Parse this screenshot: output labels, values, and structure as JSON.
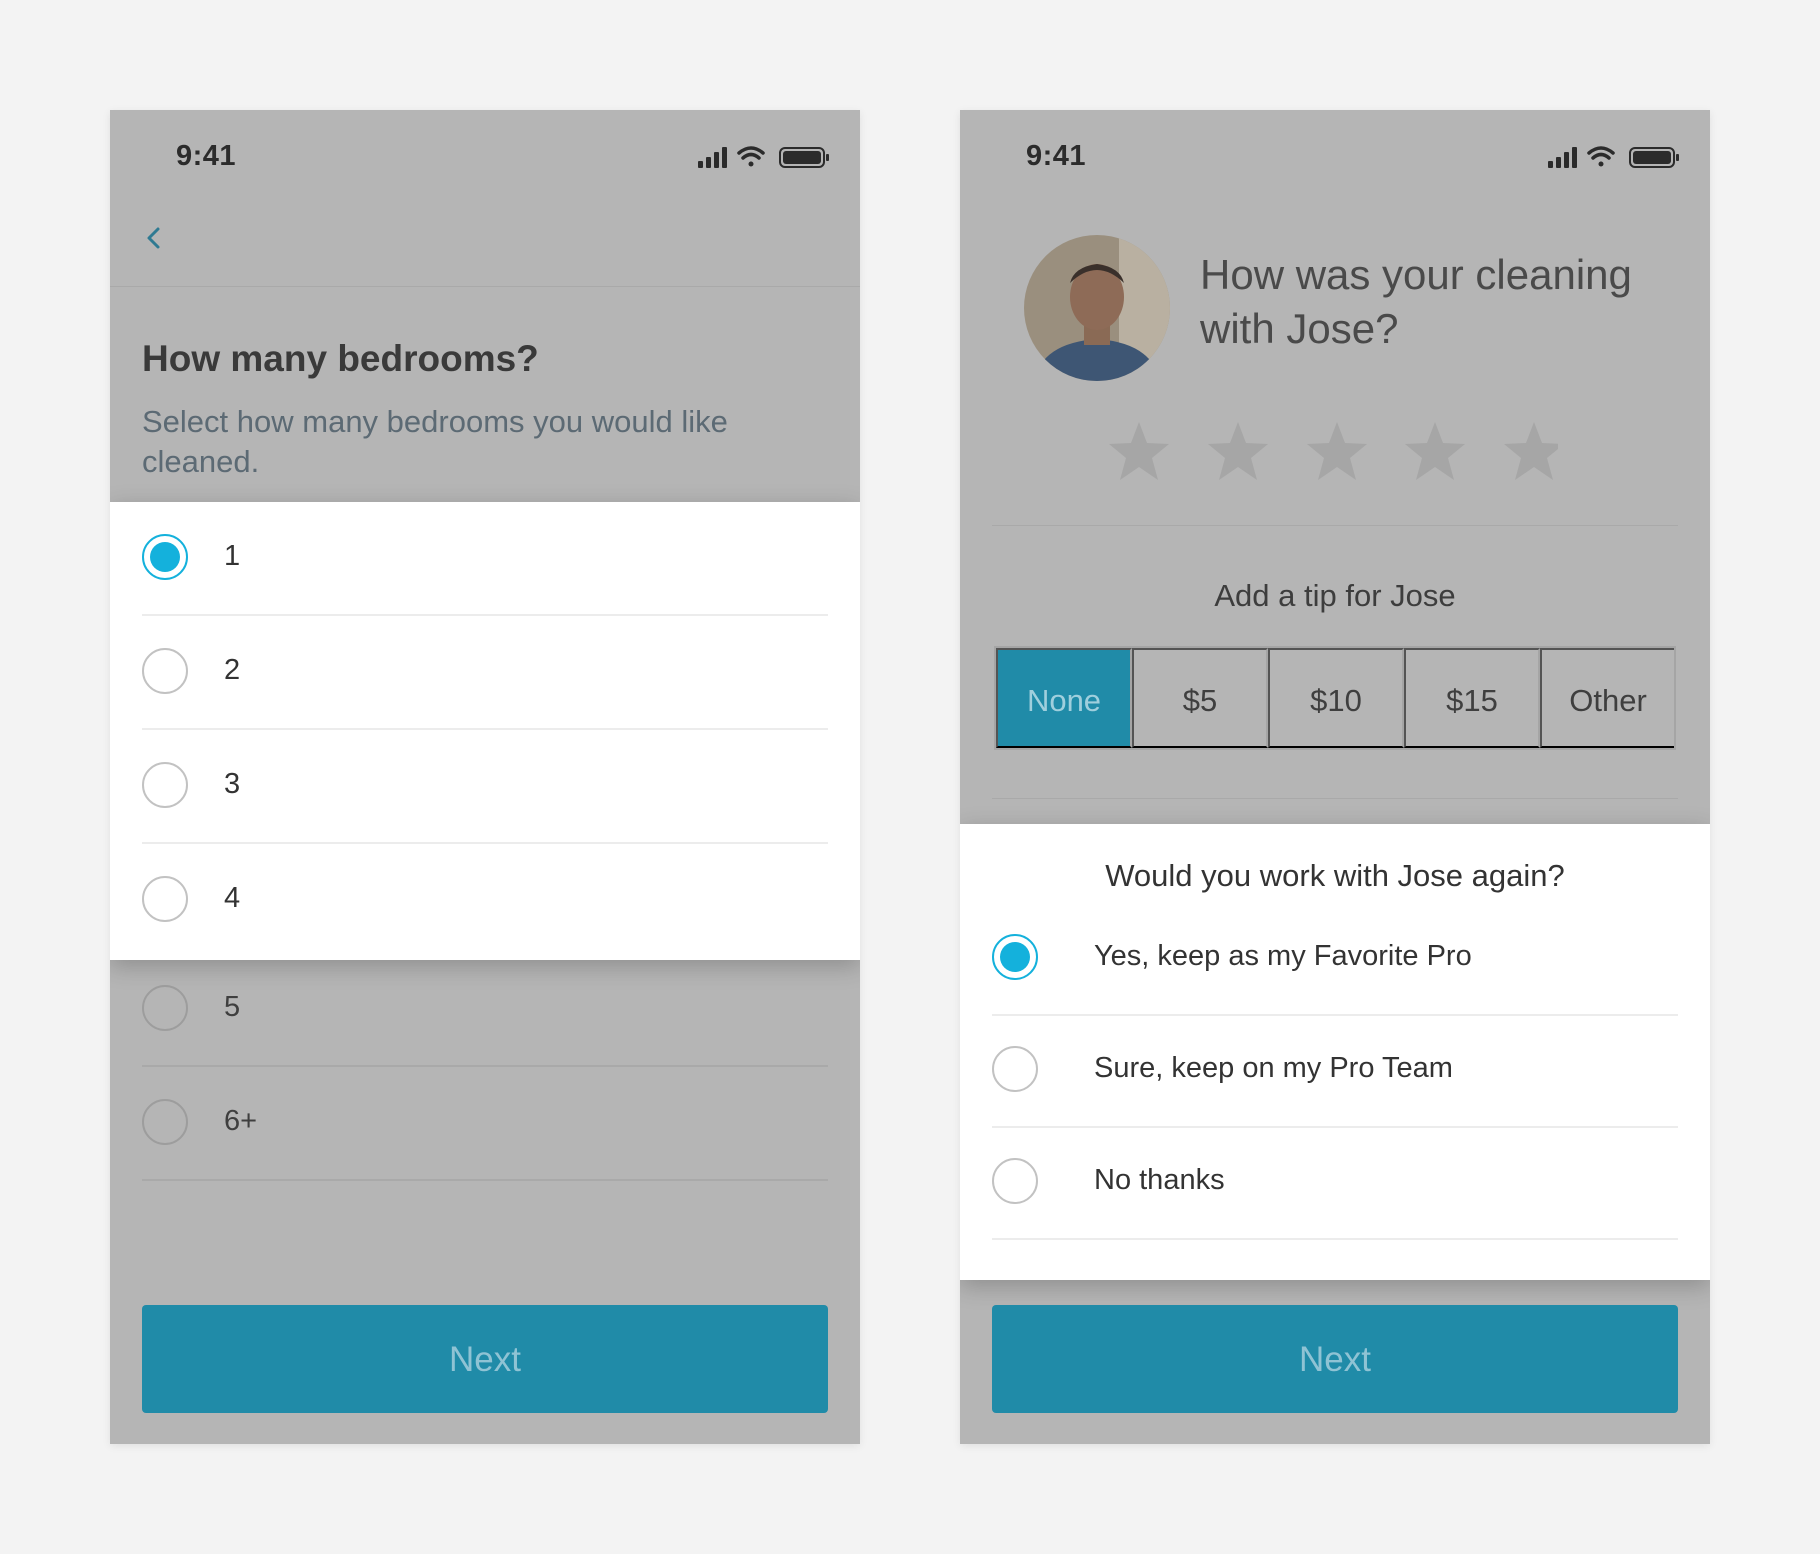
{
  "left": {
    "status_time": "9:41",
    "title": "How many bedrooms?",
    "subtitle": "Select how many bedrooms you would like cleaned.",
    "options": [
      "1",
      "2",
      "3",
      "4",
      "5",
      "6+"
    ],
    "selected_option": "1",
    "next_label": "Next"
  },
  "right": {
    "status_time": "9:41",
    "title": "How was your cleaning with Jose?",
    "rating": 0,
    "rating_max": 5,
    "tip_label": "Add a tip for Jose",
    "tips": [
      "None",
      "$5",
      "$10",
      "$15",
      "Other"
    ],
    "tip_selected": "None",
    "question": "Would you work with Jose again?",
    "options": [
      "Yes, keep as my Favorite Pro",
      "Sure, keep on my Pro Team",
      "No thanks"
    ],
    "selected_option": "Yes, keep as my Favorite Pro",
    "next_label": "Next"
  },
  "colors": {
    "accent": "#14b1dc",
    "button": "#208ba8",
    "overlay": "#b5b5b5",
    "background": "#f3f3f3"
  },
  "icons": [
    "cellular-signal-icon",
    "wifi-icon",
    "battery-icon",
    "back-chevron-icon",
    "star-icon",
    "radio-button-icon"
  ]
}
